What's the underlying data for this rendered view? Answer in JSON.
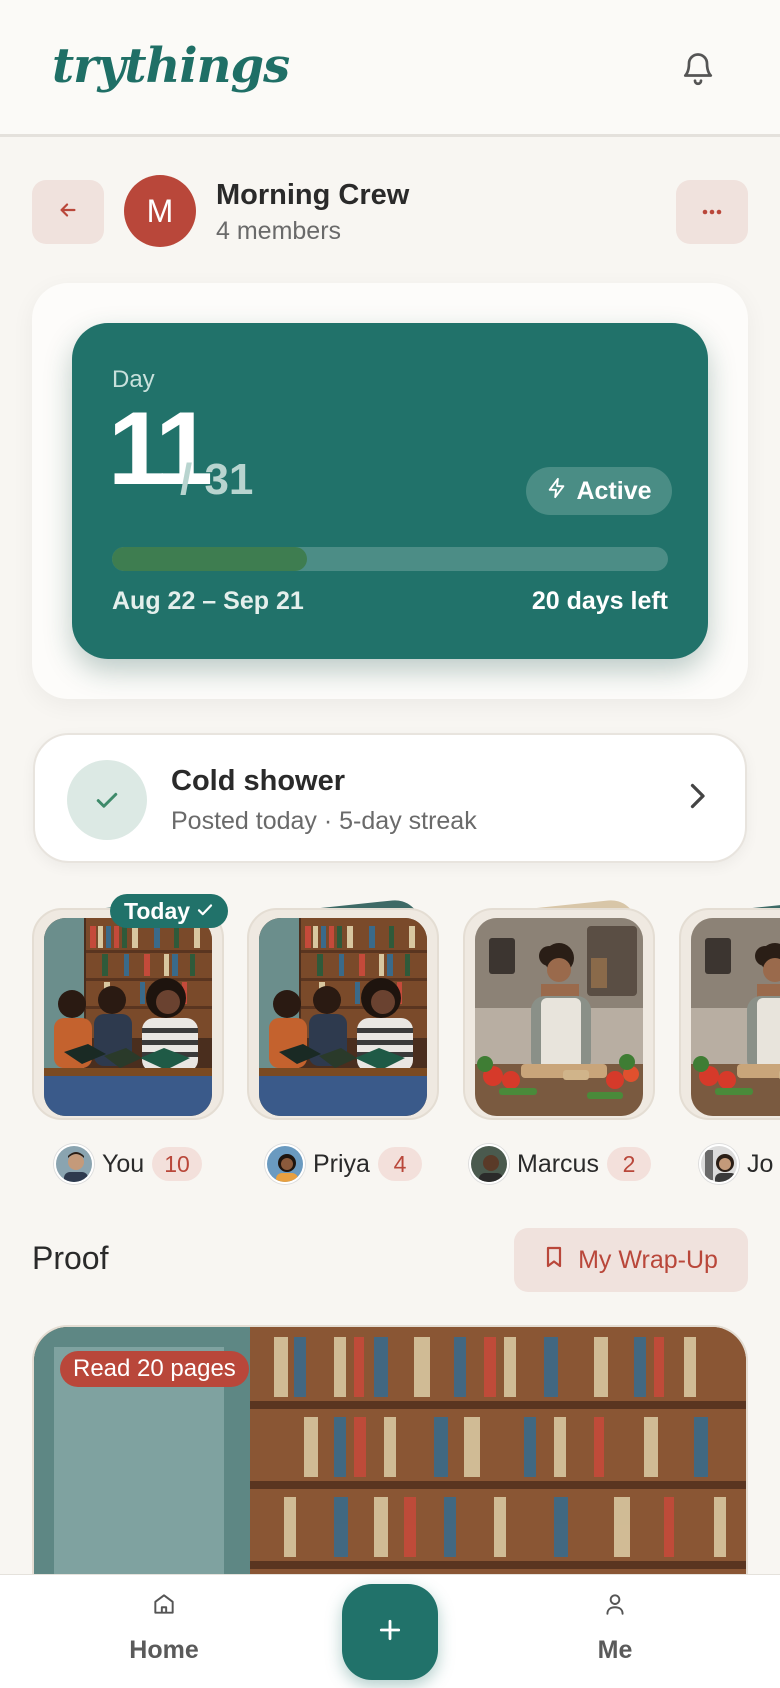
{
  "app": {
    "logo": "trythings"
  },
  "group": {
    "initial": "M",
    "name": "Morning Crew",
    "members_label": "4 members"
  },
  "challenge": {
    "day_label": "Day",
    "day_current": "11",
    "day_total": "/ 31",
    "status": "Active",
    "progress_fraction": 0.35,
    "date_range": "Aug 22 – Sep 21",
    "days_left": "20 days left"
  },
  "task": {
    "title": "Cold shower",
    "subtitle": "Posted today · 5-day streak"
  },
  "members": [
    {
      "name": "You",
      "count": "10",
      "badge": "Today"
    },
    {
      "name": "Priya",
      "count": "4"
    },
    {
      "name": "Marcus",
      "count": "2"
    },
    {
      "name": "Jo"
    }
  ],
  "proof": {
    "title": "Proof",
    "wrapup_label": "My Wrap-Up",
    "tag": "Read 20 pages"
  },
  "nav": {
    "home": "Home",
    "me": "Me"
  },
  "colors": {
    "teal": "#21726a",
    "brick": "#b9473a",
    "blush": "#f0e2dd",
    "background": "#f8f6f2"
  },
  "icons": [
    "bell-icon",
    "arrow-left-icon",
    "more-dots-icon",
    "bolt-icon",
    "check-icon",
    "chevron-right-icon",
    "bookmark-icon",
    "home-icon",
    "plus-icon",
    "person-icon"
  ]
}
